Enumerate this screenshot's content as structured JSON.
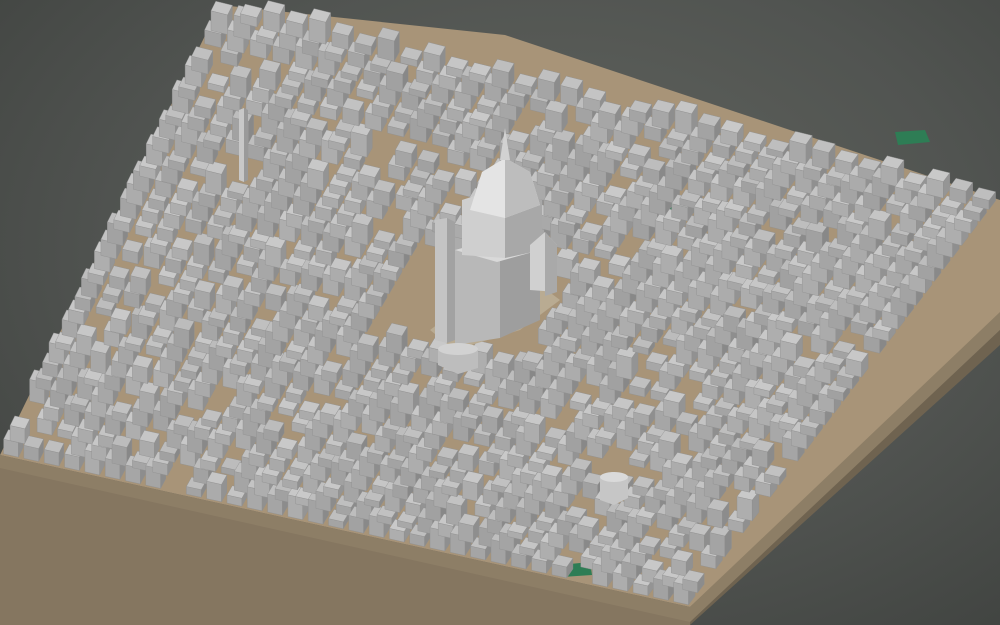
{
  "scene": {
    "subject": "3d-city-block-model",
    "colors": {
      "background": "#555855",
      "base_side": "#8a7b63",
      "ground": "#a89478",
      "building_top": "#c9c9c9",
      "building_left": "#aeaeae",
      "building_right": "#959595",
      "park": "#2e7d55",
      "cathedral": "#d6d6d6"
    }
  }
}
